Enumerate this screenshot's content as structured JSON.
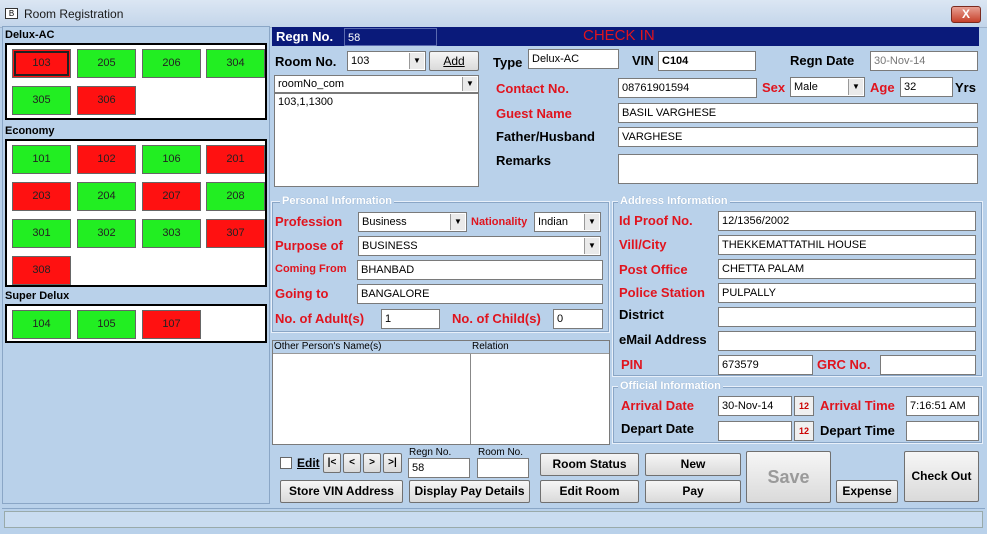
{
  "window": {
    "title": "Room Registration",
    "close": "X",
    "app_icon": "B"
  },
  "rooms": {
    "groups": [
      {
        "name": "Delux-AC",
        "rooms": [
          {
            "no": "103",
            "status": "occupied",
            "selected": true
          },
          {
            "no": "205",
            "status": "free"
          },
          {
            "no": "206",
            "status": "free"
          },
          {
            "no": "304",
            "status": "free"
          },
          {
            "no": "305",
            "status": "free"
          },
          {
            "no": "306",
            "status": "occupied"
          }
        ]
      },
      {
        "name": "Economy",
        "rooms": [
          {
            "no": "101",
            "status": "free"
          },
          {
            "no": "102",
            "status": "occupied"
          },
          {
            "no": "106",
            "status": "free"
          },
          {
            "no": "201",
            "status": "occupied"
          },
          {
            "no": "203",
            "status": "occupied"
          },
          {
            "no": "204",
            "status": "free"
          },
          {
            "no": "207",
            "status": "occupied"
          },
          {
            "no": "208",
            "status": "free"
          },
          {
            "no": "301",
            "status": "free"
          },
          {
            "no": "302",
            "status": "free"
          },
          {
            "no": "303",
            "status": "free"
          },
          {
            "no": "307",
            "status": "occupied"
          },
          {
            "no": "308",
            "status": "occupied"
          }
        ]
      },
      {
        "name": "Super Delux",
        "rooms": [
          {
            "no": "104",
            "status": "free"
          },
          {
            "no": "105",
            "status": "free"
          },
          {
            "no": "107",
            "status": "occupied"
          }
        ]
      }
    ],
    "colors": {
      "free": "#22ee22",
      "occupied": "#ff1111"
    }
  },
  "header": {
    "regn_no_label": "Regn No.",
    "regn_no_value": "58",
    "title": "CHECK IN"
  },
  "room_select": {
    "room_no_label": "Room No.",
    "room_no_value": "103",
    "add_label": "Add",
    "combo_value": "roomNo_com",
    "list_items": [
      "103,1,1300"
    ]
  },
  "top_fields": {
    "type_label": "Type",
    "type_value": "Delux-AC",
    "vin_label": "VIN",
    "vin_value": "C104",
    "regn_date_label": "Regn Date",
    "regn_date_value": "30-Nov-14",
    "contact_label": "Contact No.",
    "contact_value": "08761901594",
    "sex_label": "Sex",
    "sex_value": "Male",
    "age_label": "Age",
    "age_value": "32",
    "yrs_label": "Yrs",
    "guest_label": "Guest Name",
    "guest_value": "BASIL VARGHESE",
    "father_label": "Father/Husband",
    "father_value": "VARGHESE",
    "remarks_label": "Remarks",
    "remarks_value": ""
  },
  "personal": {
    "title": "Personal Information",
    "profession_label": "Profession",
    "profession_value": "Business",
    "nationality_label": "Nationality",
    "nationality_value": "Indian",
    "purpose_label": "Purpose of",
    "purpose_value": "BUSINESS",
    "coming_label": "Coming From",
    "coming_value": "BHANBAD",
    "going_label": "Going to",
    "going_value": "BANGALORE",
    "adults_label": "No. of Adult(s)",
    "adults_value": "1",
    "childs_label": "No. of Child(s)",
    "childs_value": "0",
    "other_names_header": "Other Person's Name(s)",
    "relation_header": "Relation"
  },
  "address": {
    "title": "Address Information",
    "idproof_label": "Id Proof No.",
    "idproof_value": "12/1356/2002",
    "vill_label": "Vill/City",
    "vill_value": "THEKKEMATTATHIL HOUSE",
    "post_label": "Post Office",
    "post_value": "CHETTA PALAM",
    "police_label": "Police Station",
    "police_value": "PULPALLY",
    "district_label": "District",
    "district_value": "",
    "email_label": "eMail Address",
    "email_value": "",
    "pin_label": "PIN",
    "pin_value": "673579",
    "grc_label": "GRC No.",
    "grc_value": ""
  },
  "official": {
    "title": "Official Information",
    "arrival_date_label": "Arrival Date",
    "arrival_date_value": "30-Nov-14",
    "arrival_time_label": "Arrival Time",
    "arrival_time_value": "7:16:51 AM",
    "depart_date_label": "Depart Date",
    "depart_date_value": "",
    "depart_time_label": "Depart Time",
    "depart_time_value": "",
    "cal_icon": "12"
  },
  "footer": {
    "edit_label": "Edit",
    "nav_first": "|<",
    "nav_prev": "<",
    "nav_next": ">",
    "nav_last": ">|",
    "regn_no_label": "Regn No.",
    "regn_no_value": "58",
    "room_no_label": "Room No.",
    "room_no_value": "",
    "room_status": "Room Status",
    "new": "New",
    "save": "Save",
    "check_out": "Check Out",
    "store_vin": "Store VIN Address",
    "display_pay": "Display Pay Details",
    "edit_room": "Edit Room",
    "pay": "Pay",
    "expense": "Expense"
  },
  "status_bar": {
    "text": ""
  }
}
